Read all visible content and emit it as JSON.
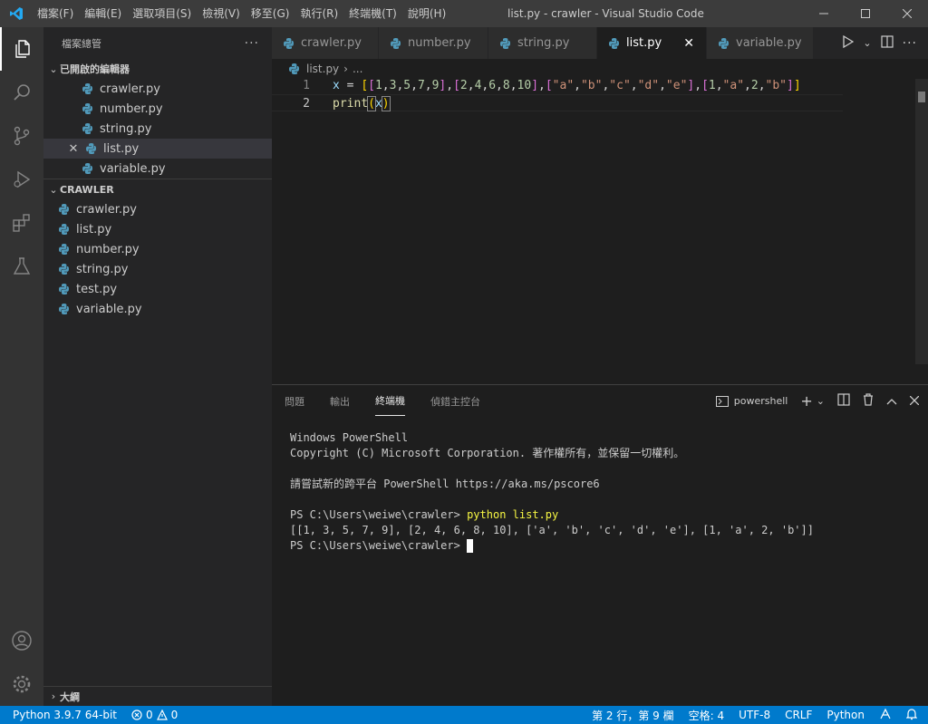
{
  "titlebar": {
    "menu": [
      "檔案(F)",
      "編輯(E)",
      "選取項目(S)",
      "檢視(V)",
      "移至(G)",
      "執行(R)",
      "終端機(T)",
      "說明(H)"
    ],
    "title": "list.py - crawler - Visual Studio Code"
  },
  "sidebar": {
    "header": "檔案總管",
    "open_editors_title": "已開啟的編輯器",
    "open_editors": [
      "crawler.py",
      "number.py",
      "string.py",
      "list.py",
      "variable.py"
    ],
    "folder_title": "CRAWLER",
    "files": [
      "crawler.py",
      "list.py",
      "number.py",
      "string.py",
      "test.py",
      "variable.py"
    ],
    "outline_title": "大綱"
  },
  "tabs": [
    "crawler.py",
    "number.py",
    "string.py",
    "list.py",
    "variable.py"
  ],
  "breadcrumb": {
    "file": "list.py",
    "rest": "..."
  },
  "editor": {
    "line_numbers": [
      "1",
      "2"
    ]
  },
  "panel": {
    "tabs": [
      "問題",
      "輸出",
      "終端機",
      "偵錯主控台"
    ],
    "terminal_name": "powershell",
    "terminal_lines": [
      "Windows PowerShell",
      "Copyright (C) Microsoft Corporation. 著作權所有，並保留一切權利。",
      "",
      "請嘗試新的跨平台 PowerShell https://aka.ms/pscore6",
      ""
    ],
    "prompt": "PS C:\\Users\\weiwe\\crawler> ",
    "command": "python list.py",
    "output": "[[1, 3, 5, 7, 9], [2, 4, 6, 8, 10], ['a', 'b', 'c', 'd', 'e'], [1, 'a', 2, 'b']]",
    "prompt2": "PS C:\\Users\\weiwe\\crawler> "
  },
  "statusbar": {
    "python": "Python 3.9.7 64-bit",
    "errors": "0",
    "warnings": "0",
    "position": "第 2 行，第 9 欄",
    "spaces": "空格: 4",
    "encoding": "UTF-8",
    "eol": "CRLF",
    "language": "Python"
  },
  "colors": {
    "accent": "#007acc",
    "python_icon": "#519aba"
  }
}
